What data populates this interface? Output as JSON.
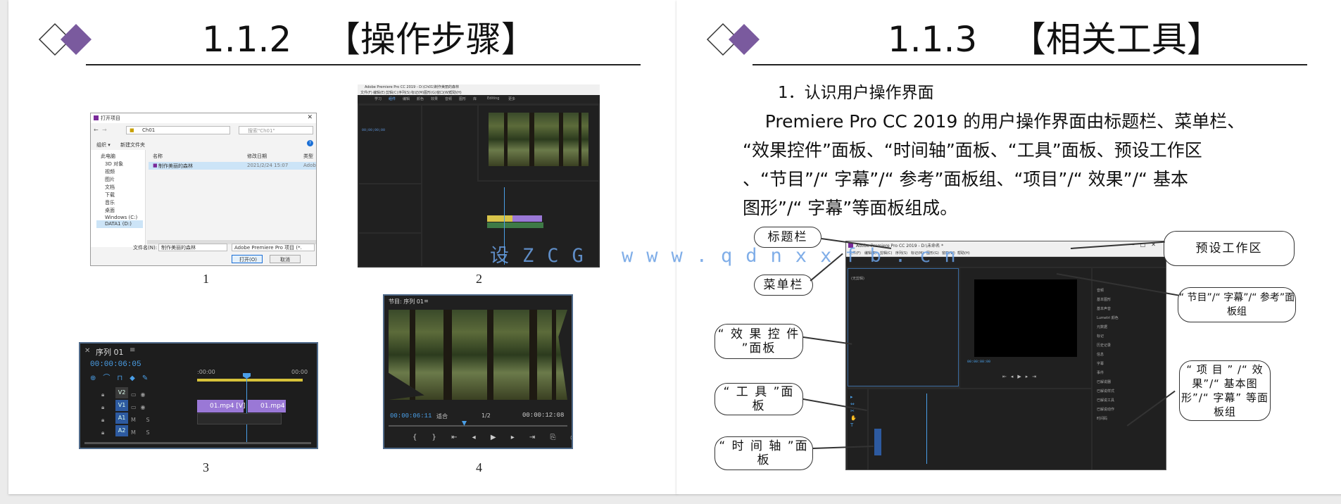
{
  "left": {
    "title": "1.1.2   【操作步骤】",
    "captions": [
      "1",
      "2",
      "3",
      "4"
    ],
    "dialog": {
      "title": "打开项目",
      "path": "Ch01",
      "search_placeholder": "搜索\"Ch01\"",
      "organize": "组织 ▾",
      "new_folder": "新建文件夹",
      "col_name": "名称",
      "col_date": "修改日期",
      "col_type": "类型",
      "file_name": "制作美丽的森林",
      "file_date": "2021/2/24 15:07",
      "file_type": "Adob",
      "tree": [
        "此电脑",
        "3D 对象",
        "视频",
        "图片",
        "文档",
        "下载",
        "音乐",
        "桌面",
        "Windows (C:)",
        "DATA1 (D:)"
      ],
      "filename_label": "文件名(N):",
      "filename_value": "制作美丽的森林",
      "filetype_value": "Adobe Premiere Pro 项目 (*.",
      "open_button": "打开(O)",
      "cancel_button": "取消"
    },
    "premiere": {
      "window_title": "Adobe Premiere Pro CC 2019 - D:\\Ch01\\制作美丽的森林",
      "menu": [
        "文件(F)",
        "编辑(E)",
        "剪辑(C)",
        "序列(S)",
        "标记(M)",
        "图形(G)",
        "窗口(W)",
        "帮助(H)"
      ],
      "tabs": [
        "学习",
        "组件",
        "编辑",
        "颜色",
        "效果",
        "音频",
        "图形",
        "库",
        "Editing",
        "更多"
      ],
      "timecode": "00;00;00;00"
    },
    "timeline": {
      "title": "序列 01",
      "timecode": "00:00:06:05",
      "ruler_start": ":00:00",
      "ruler_end": "00:00",
      "tracks": [
        "V2",
        "V1",
        "A1",
        "A2"
      ],
      "clip1": "01.mp4 [V]",
      "clip2": "01.mp4"
    },
    "program": {
      "title": "节目: 序列 01",
      "timecode_left": "00:00:06:11",
      "fit": "适合",
      "ratio": "1/2",
      "timecode_right": "00:00:12:08"
    }
  },
  "right": {
    "title": "1.1.3   【相关工具】",
    "heading": "1．认识用户操作界面",
    "paragraph_lines": [
      "    Premiere Pro CC 2019 的用户操作界面由标题栏、菜单栏、",
      "“效果控件”面板、“时间轴”面板、“工具”面板、预设工作区",
      "、“节目”/“ 字幕”/“ 参考”面板组、“项目”/“ 效果”/“ 基本",
      "图形”/“ 字幕”等面板组成。"
    ],
    "callouts": {
      "title_bar": "标题栏",
      "menu_bar": "菜单栏",
      "effect_controls": "“ 效 果 控 件 ”面板",
      "tools": "“ 工 具 ”面 板",
      "timeline": "“ 时 间 轴 ”面 板",
      "workspace": "预设工作区",
      "program_group": "“ 节目”/“ 字幕”/“ 参考”面板组",
      "project_group": "“ 项 目 ” /“ 效 果”/“ 基本图 形”/“ 字幕” 等面板组"
    },
    "screenshot": {
      "window_title": "Adobe Premiere Pro CC 2019 - D:\\未命名 *",
      "menu": [
        "文件(F)",
        "编辑(E)",
        "剪辑(C)",
        "序列(S)",
        "标记(M)",
        "图形(G)",
        "窗口(W)",
        "帮助(H)"
      ],
      "source_label": "(无剪辑)",
      "timecode": "00:00:00:00",
      "side_items": [
        "音频",
        "基本图形",
        "基本声音",
        "Lumetri 颜色",
        "元数据",
        "标记",
        "历史记录",
        "信息",
        "字幕",
        "事件",
        "已解说器",
        "已解说样式",
        "已解说工具",
        "已解说动作",
        "时间码"
      ]
    }
  },
  "watermark": "设ZCG www.qdnxxfb.cn"
}
